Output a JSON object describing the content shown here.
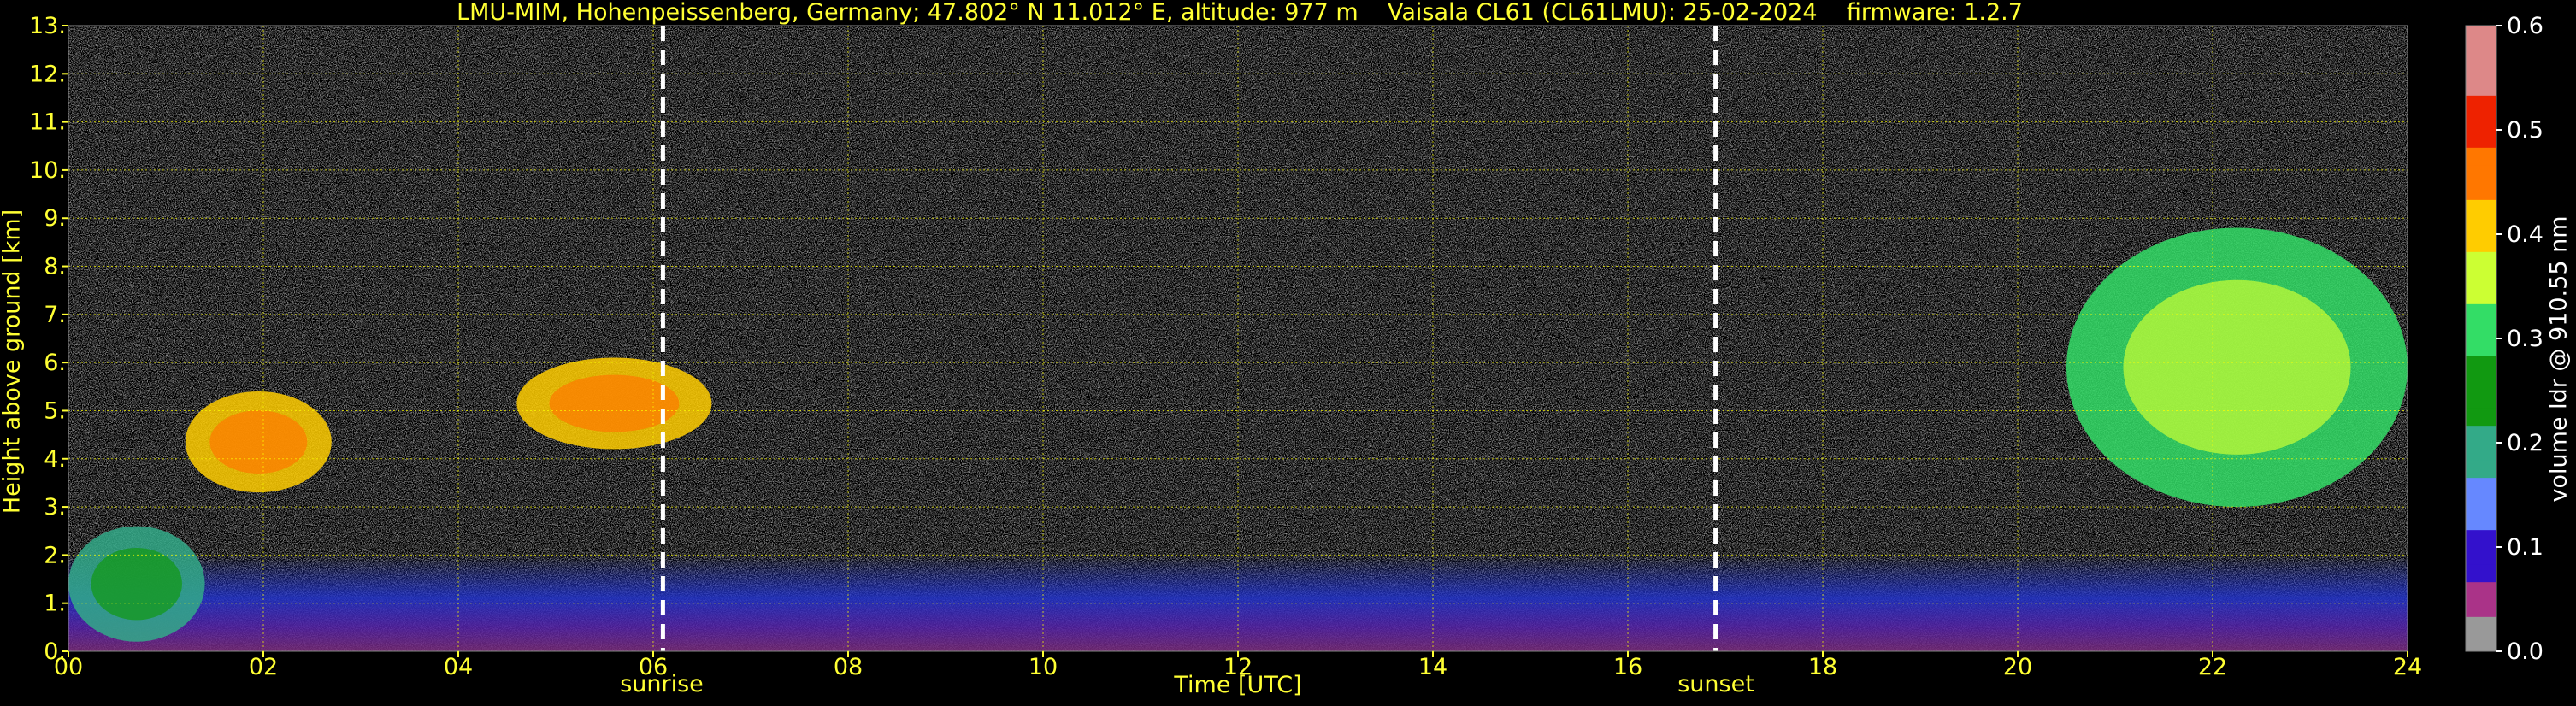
{
  "title": "LMU-MIM, Hohenpeissenberg, Germany; 47.802° N 11.012° E, altitude: 977 m    Vaisala CL61 (CL61LMU): 25-02-2024    firmware: 1.2.7",
  "chart_data": {
    "type": "heatmap",
    "xlabel": "Time [UTC]",
    "ylabel": "Height above ground [km]",
    "colorbar_label": "volume ldr @ 910.55 nm",
    "xlim": [
      0,
      24
    ],
    "ylim": [
      0,
      13
    ],
    "x_ticks": [
      "00",
      "02",
      "04",
      "06",
      "08",
      "10",
      "12",
      "14",
      "16",
      "18",
      "20",
      "22",
      "24"
    ],
    "y_ticks": [
      "0.",
      "1.",
      "2.",
      "3.",
      "4.",
      "5.",
      "6.",
      "7.",
      "8.",
      "9.",
      "10.",
      "11.",
      "12.",
      "13."
    ],
    "colorbar_ticks": [
      "0.0",
      "0.1",
      "0.2",
      "0.3",
      "0.4",
      "0.5",
      "0.6"
    ],
    "colorbar_range": [
      0,
      0.6
    ],
    "grid": true,
    "markers": [
      {
        "label": "sunrise",
        "time": 6.1
      },
      {
        "label": "sunset",
        "time": 16.9
      }
    ],
    "features": [
      {
        "desc": "cloud",
        "t0": 1.2,
        "t1": 2.7,
        "h0": 3.3,
        "h1": 5.4,
        "ldr": 0.42
      },
      {
        "desc": "cloud",
        "t0": 4.6,
        "t1": 6.6,
        "h0": 4.2,
        "h1": 6.1,
        "ldr": 0.4
      },
      {
        "desc": "cloud",
        "t0": 0.0,
        "t1": 1.4,
        "h0": 0.2,
        "h1": 2.6,
        "ldr": 0.2
      },
      {
        "desc": "cloud",
        "t0": 20.5,
        "t1": 24.0,
        "h0": 3.0,
        "h1": 8.8,
        "ldr": 0.3
      }
    ],
    "colors": {
      "background": "#000000",
      "text": "#ffff33",
      "grid": "#ffff00",
      "marker": "#ffffff"
    }
  }
}
